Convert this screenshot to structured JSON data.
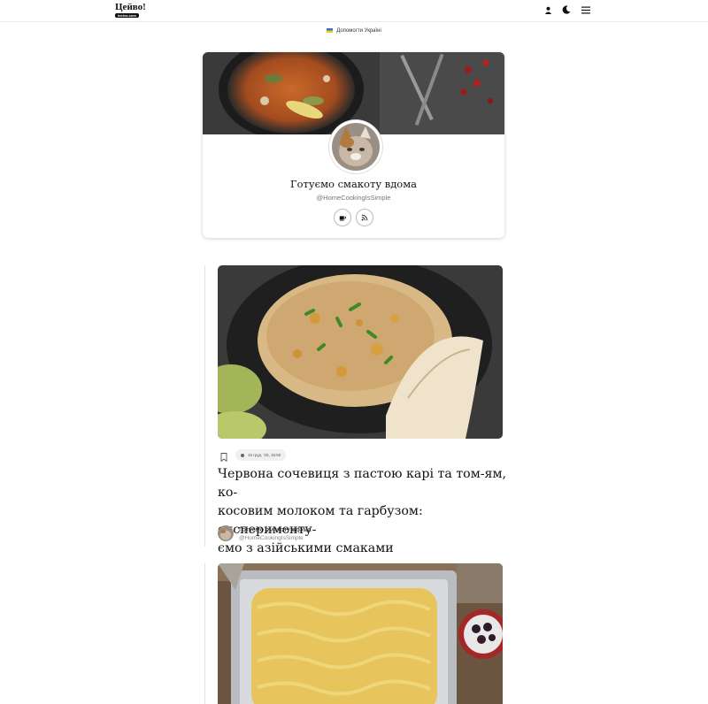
{
  "header": {
    "logo_title": "Цейво!",
    "logo_domain": "teeivo.com",
    "icons": [
      "user-icon",
      "moon-icon",
      "menu-icon"
    ]
  },
  "help_banner": {
    "text": "Допомогти Україні"
  },
  "profile": {
    "name": "Готуємо смакоту вдома",
    "handle": "@HomeCookingIsSimple",
    "buttons": [
      "coffee-icon",
      "rss-icon"
    ]
  },
  "posts": [
    {
      "date": "15 груд. '25, 16:50",
      "title": "Червона сочевиця з пастою карі та том-ям, ко-косовим молоком та гарбузом: експерименту-ємо з азійськими смаками",
      "title_lines": [
        "Червона сочевиця з пастою карі та том-ям, ко-",
        "косовим молоком та гарбузом: експерименту-",
        "ємо з азійськими смаками"
      ],
      "author_name": "Готуємо смакоту вдома",
      "author_handle": "@HomeCookingIsSimple"
    }
  ],
  "colors": {
    "accent_flag_blue": "#2f6fd6",
    "accent_flag_yellow": "#f6d000"
  }
}
